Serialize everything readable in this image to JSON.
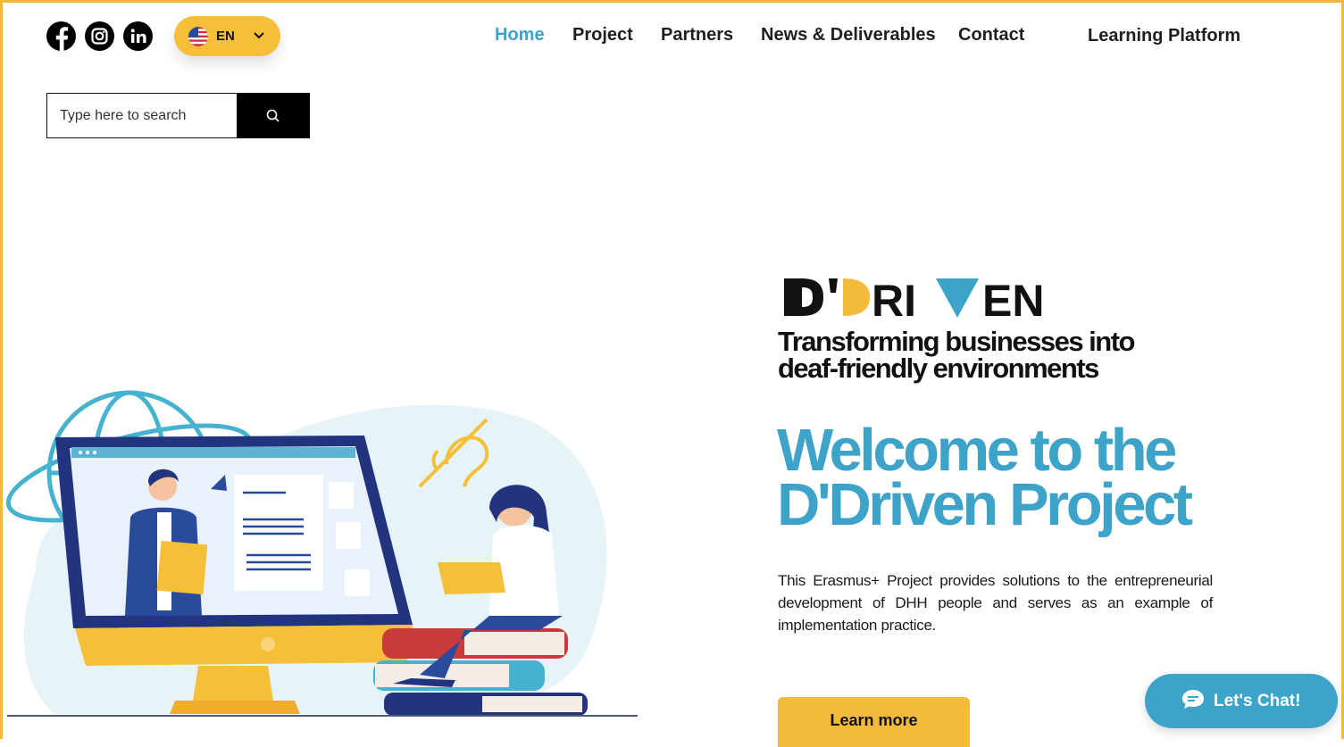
{
  "social": {
    "icons": [
      "facebook-icon",
      "instagram-icon",
      "linkedin-icon"
    ]
  },
  "language": {
    "code": "EN",
    "flag_icon": "us-flag-icon"
  },
  "nav": {
    "items": [
      "Home",
      "Project",
      "Partners",
      "News & Deliverables",
      "Contact",
      "Learning Platform"
    ],
    "active": "Home"
  },
  "search": {
    "placeholder": "Type here to search",
    "icon": "search-icon"
  },
  "hero": {
    "logo_text": "D'DRIVEN",
    "tagline_line1": "Transforming businesses into",
    "tagline_line2": "deaf-friendly environments",
    "welcome_line1": "Welcome to the",
    "welcome_line2": "D'Driven Project",
    "description": "This Erasmus+ Project provides solutions to the entrepreneurial development of DHH people and serves as an example of implementation practice.",
    "cta": "Learn more"
  },
  "chat": {
    "label": "Let's Chat!",
    "icon": "chat-bubble-icon"
  },
  "colors": {
    "accent": "#3ea3c8",
    "brand_yellow": "#f3bb3c",
    "navy": "#233a86"
  }
}
